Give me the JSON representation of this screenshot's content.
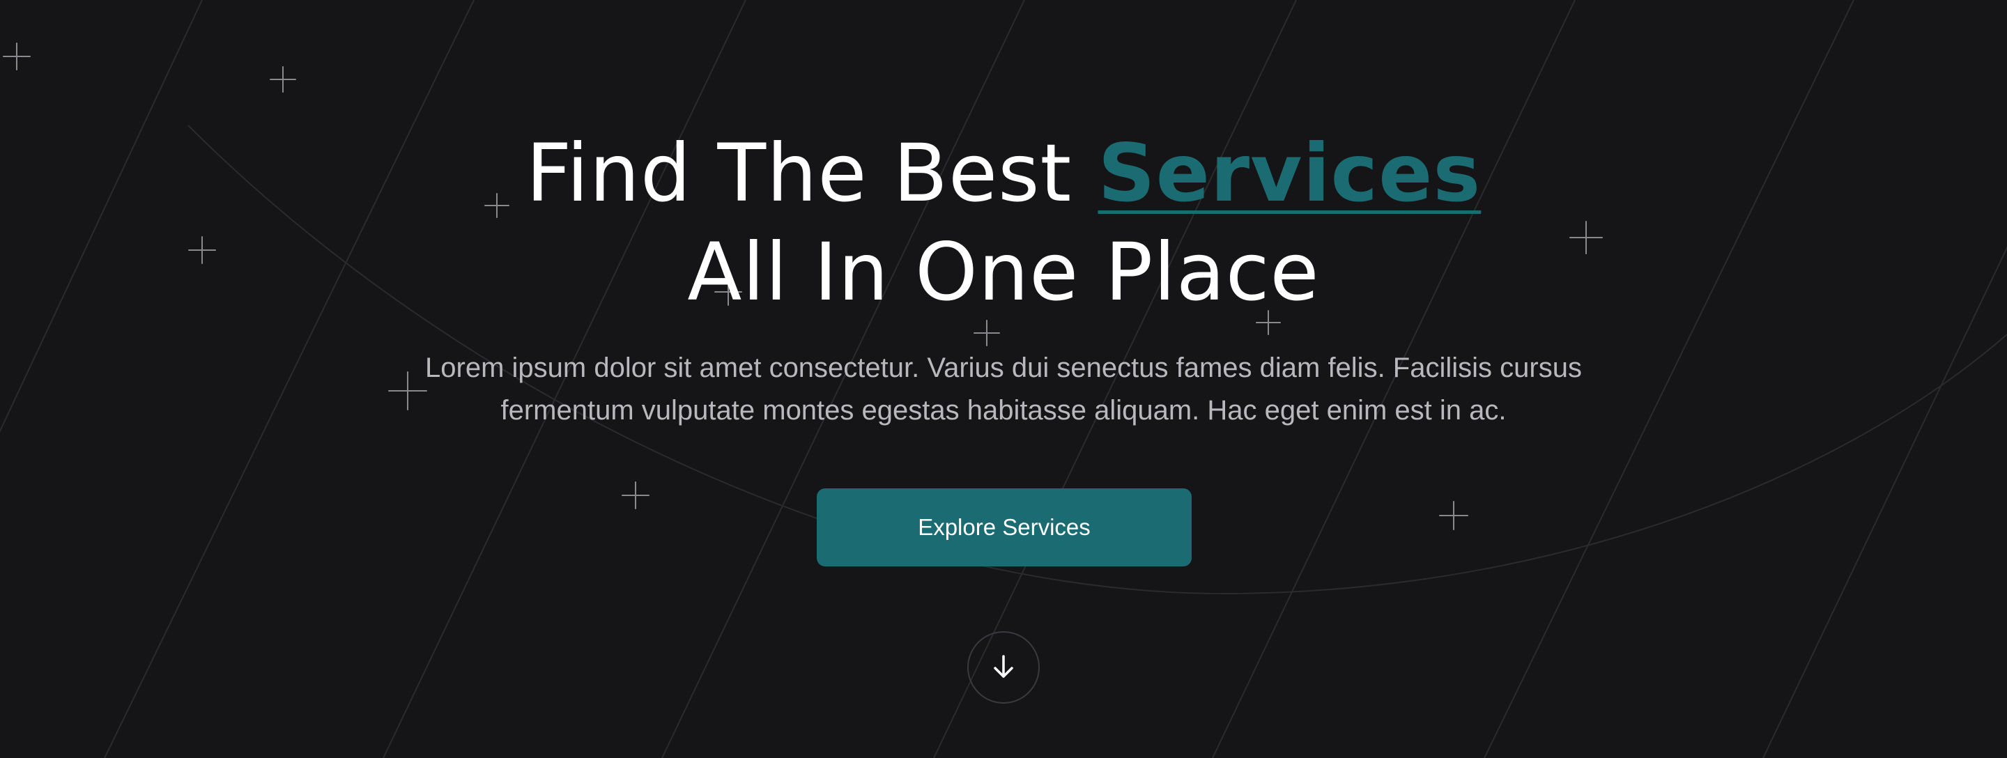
{
  "hero": {
    "headline_prefix": "Find The Best ",
    "headline_accent": "Services",
    "headline_line2": "All In One Place",
    "subtitle": "Lorem ipsum dolor sit amet consectetur. Varius dui senectus fames diam felis. Facilisis cursus fermentum vulputate montes egestas habitasse aliquam. Hac eget enim est in ac.",
    "cta_label": "Explore Services"
  },
  "colors": {
    "background": "#151417",
    "accent": "#1b6b72",
    "headline": "#ffffff",
    "subtitle": "#b9b8bd"
  },
  "icons": {
    "scroll": "arrow-down-icon",
    "decoration": "sparkle-icon"
  }
}
